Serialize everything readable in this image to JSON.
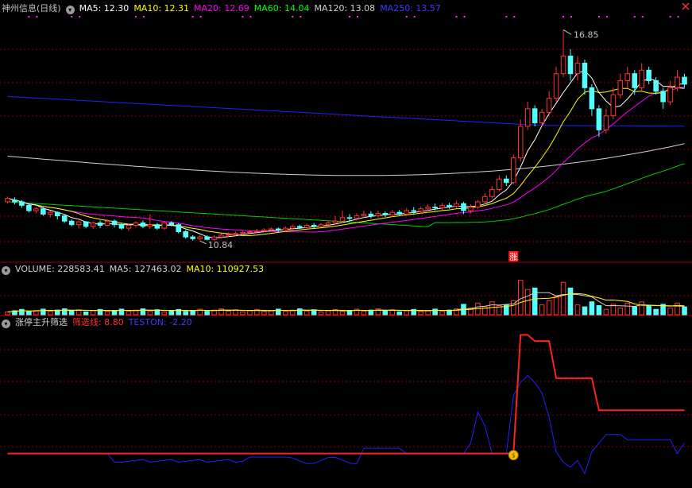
{
  "main": {
    "title": "神州信息(日线)",
    "ma": [
      {
        "label": "MA5: 12.30",
        "color": "#ffffff"
      },
      {
        "label": "MA10: 12.31",
        "color": "#ffff00"
      },
      {
        "label": "MA20: 12.69",
        "color": "#ff00ff"
      },
      {
        "label": "MA60: 14.04",
        "color": "#00ff00"
      },
      {
        "label": "MA120: 13.08",
        "color": "#ffffff"
      },
      {
        "label": "MA250: 13.57",
        "color": "#0000ff"
      }
    ],
    "high_label": "16.85",
    "low_label": "10.84",
    "limit_up_marker": "涨"
  },
  "volume": {
    "title": "VOLUME: 228583.41",
    "ma5": "MA5: 127463.02",
    "ma10": "MA10: 110927.53"
  },
  "indicator": {
    "title": "涨停主升筛选",
    "line1": "筛选线: 8.80",
    "line2": "TESTON: -2.20"
  },
  "colors": {
    "up": "#ff3232",
    "down": "#54ffff",
    "grid": "#8b0000",
    "ma250": "#2020ff",
    "ma120": "#d0d0d0",
    "ma60": "#00cc00",
    "ma20": "#ff00ff",
    "ma10": "#ffff00",
    "ma5": "#ffffff"
  },
  "chart_data": {
    "type": "candlestick",
    "price_range": [
      10.5,
      17.2
    ],
    "candles": [
      [
        11.95,
        12.05,
        11.9,
        12.1
      ],
      [
        12.0,
        11.95,
        11.88,
        12.08
      ],
      [
        11.95,
        11.85,
        11.78,
        12.0
      ],
      [
        11.85,
        11.7,
        11.65,
        11.9
      ],
      [
        11.7,
        11.75,
        11.62,
        11.8
      ],
      [
        11.75,
        11.6,
        11.55,
        11.8
      ],
      [
        11.6,
        11.65,
        11.5,
        11.7
      ],
      [
        11.65,
        11.55,
        11.45,
        11.68
      ],
      [
        11.55,
        11.4,
        11.35,
        11.58
      ],
      [
        11.4,
        11.3,
        11.25,
        11.45
      ],
      [
        11.3,
        11.38,
        11.2,
        11.42
      ],
      [
        11.38,
        11.25,
        11.2,
        11.4
      ],
      [
        11.25,
        11.35,
        11.18,
        11.4
      ],
      [
        11.35,
        11.28,
        11.2,
        11.42
      ],
      [
        11.28,
        11.4,
        11.25,
        11.45
      ],
      [
        11.4,
        11.3,
        11.22,
        11.45
      ],
      [
        11.3,
        11.2,
        11.15,
        11.35
      ],
      [
        11.2,
        11.28,
        11.12,
        11.32
      ],
      [
        11.28,
        11.35,
        11.22,
        11.4
      ],
      [
        11.35,
        11.25,
        11.2,
        11.42
      ],
      [
        11.25,
        11.3,
        11.18,
        11.6
      ],
      [
        11.3,
        11.2,
        11.15,
        11.35
      ],
      [
        11.2,
        11.35,
        11.15,
        11.38
      ],
      [
        11.35,
        11.3,
        11.25,
        11.4
      ],
      [
        11.3,
        11.1,
        11.05,
        11.35
      ],
      [
        11.1,
        10.95,
        10.9,
        11.15
      ],
      [
        10.95,
        10.9,
        10.84,
        11.0
      ],
      [
        10.9,
        10.95,
        10.86,
        11.0
      ],
      [
        10.95,
        10.88,
        10.85,
        11.0
      ],
      [
        10.88,
        10.95,
        10.84,
        11.0
      ],
      [
        10.95,
        11.0,
        10.9,
        11.05
      ],
      [
        11.0,
        11.02,
        10.95,
        11.08
      ],
      [
        11.02,
        11.05,
        10.98,
        11.1
      ],
      [
        11.05,
        11.08,
        11.0,
        11.12
      ],
      [
        11.08,
        11.1,
        11.05,
        11.15
      ],
      [
        11.1,
        11.12,
        11.05,
        11.18
      ],
      [
        11.12,
        11.15,
        11.08,
        11.2
      ],
      [
        11.15,
        11.18,
        11.1,
        11.22
      ],
      [
        11.18,
        11.15,
        11.1,
        11.22
      ],
      [
        11.15,
        11.2,
        11.1,
        11.25
      ],
      [
        11.2,
        11.25,
        11.15,
        11.3
      ],
      [
        11.25,
        11.22,
        11.18,
        11.3
      ],
      [
        11.22,
        11.28,
        11.18,
        11.32
      ],
      [
        11.28,
        11.25,
        11.2,
        11.35
      ],
      [
        11.25,
        11.3,
        11.22,
        11.35
      ],
      [
        11.3,
        11.35,
        11.25,
        11.4
      ],
      [
        11.35,
        11.4,
        11.3,
        11.55
      ],
      [
        11.4,
        11.5,
        11.35,
        11.7
      ],
      [
        11.5,
        11.48,
        11.4,
        11.6
      ],
      [
        11.48,
        11.55,
        11.42,
        11.62
      ],
      [
        11.55,
        11.6,
        11.5,
        11.7
      ],
      [
        11.6,
        11.55,
        11.48,
        11.68
      ],
      [
        11.55,
        11.62,
        11.5,
        11.7
      ],
      [
        11.62,
        11.58,
        11.52,
        11.68
      ],
      [
        11.58,
        11.65,
        11.52,
        11.72
      ],
      [
        11.65,
        11.6,
        11.55,
        11.72
      ],
      [
        11.6,
        11.7,
        11.55,
        11.78
      ],
      [
        11.7,
        11.68,
        11.6,
        11.8
      ],
      [
        11.68,
        11.75,
        11.62,
        11.82
      ],
      [
        11.75,
        11.8,
        11.7,
        11.88
      ],
      [
        11.8,
        11.78,
        11.7,
        11.9
      ],
      [
        11.78,
        11.85,
        11.72,
        11.92
      ],
      [
        11.85,
        11.82,
        11.75,
        11.92
      ],
      [
        11.82,
        11.9,
        11.78,
        11.98
      ],
      [
        11.9,
        11.7,
        11.6,
        11.95
      ],
      [
        11.7,
        11.8,
        11.62,
        11.88
      ],
      [
        11.8,
        11.95,
        11.75,
        12.0
      ],
      [
        11.95,
        12.1,
        11.88,
        12.2
      ],
      [
        12.1,
        12.3,
        12.05,
        12.4
      ],
      [
        12.3,
        12.6,
        12.25,
        12.7
      ],
      [
        12.6,
        12.5,
        12.4,
        12.7
      ],
      [
        12.5,
        13.2,
        12.45,
        13.3
      ],
      [
        13.2,
        14.1,
        13.1,
        14.3
      ],
      [
        14.1,
        14.6,
        14.0,
        14.8
      ],
      [
        14.6,
        14.2,
        14.1,
        14.7
      ],
      [
        14.2,
        14.5,
        14.1,
        14.6
      ],
      [
        14.5,
        14.9,
        14.4,
        15.1
      ],
      [
        14.9,
        15.6,
        14.8,
        15.8
      ],
      [
        15.6,
        16.1,
        15.5,
        16.85
      ],
      [
        16.1,
        15.6,
        15.4,
        16.3
      ],
      [
        15.6,
        15.9,
        15.4,
        16.1
      ],
      [
        15.9,
        15.2,
        15.0,
        16.0
      ],
      [
        15.2,
        14.6,
        14.4,
        15.3
      ],
      [
        14.6,
        14.0,
        13.8,
        14.7
      ],
      [
        14.0,
        14.4,
        13.9,
        14.6
      ],
      [
        14.4,
        15.0,
        14.3,
        15.2
      ],
      [
        15.0,
        15.4,
        14.9,
        15.6
      ],
      [
        15.4,
        15.6,
        15.2,
        15.8
      ],
      [
        15.6,
        15.2,
        15.0,
        15.7
      ],
      [
        15.2,
        15.7,
        15.1,
        15.9
      ],
      [
        15.7,
        15.4,
        15.3,
        15.8
      ],
      [
        15.4,
        15.1,
        15.0,
        15.5
      ],
      [
        15.1,
        14.8,
        14.6,
        15.2
      ],
      [
        14.8,
        15.2,
        14.7,
        15.4
      ],
      [
        15.2,
        15.5,
        15.1,
        15.7
      ],
      [
        15.5,
        15.3,
        15.2,
        15.6
      ]
    ],
    "volume_range": [
      0,
      260000
    ],
    "indicator_range": [
      -6,
      12
    ]
  }
}
